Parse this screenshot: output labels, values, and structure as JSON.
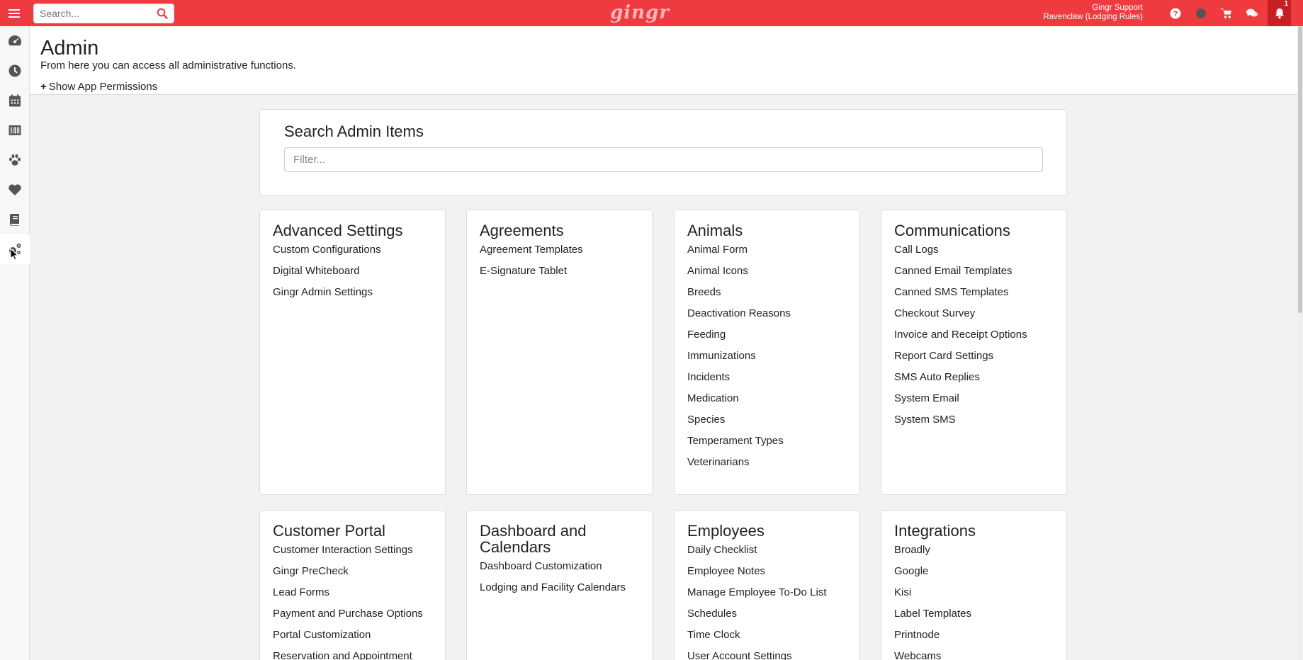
{
  "topbar": {
    "search_placeholder": "Search...",
    "logo_text": "gingr",
    "user_name": "Gingr Support",
    "location": "Ravenclaw (Lodging Rules)",
    "notification_count": "1",
    "brand_color": "#ef3b3f"
  },
  "sidebar": {
    "items": [
      {
        "icon": "dashboard-gauge-icon"
      },
      {
        "icon": "clock-icon"
      },
      {
        "icon": "calendar-icon"
      },
      {
        "icon": "barcode-icon"
      },
      {
        "icon": "paw-icon"
      },
      {
        "icon": "heart-icon"
      },
      {
        "icon": "book-icon"
      },
      {
        "icon": "admin-gears-icon",
        "active": true
      }
    ]
  },
  "header": {
    "title": "Admin",
    "description": "From here you can access all administrative functions.",
    "permissions_link": "Show App Permissions"
  },
  "search_panel": {
    "title": "Search Admin Items",
    "placeholder": "Filter..."
  },
  "cards": [
    {
      "title": "Advanced Settings",
      "items": [
        "Custom Configurations",
        "Digital Whiteboard",
        "Gingr Admin Settings"
      ]
    },
    {
      "title": "Agreements",
      "items": [
        "Agreement Templates",
        "E-Signature Tablet"
      ]
    },
    {
      "title": "Animals",
      "items": [
        "Animal Form",
        "Animal Icons",
        "Breeds",
        "Deactivation Reasons",
        "Feeding",
        "Immunizations",
        "Incidents",
        "Medication",
        "Species",
        "Temperament Types",
        "Veterinarians"
      ]
    },
    {
      "title": "Communications",
      "items": [
        "Call Logs",
        "Canned Email Templates",
        "Canned SMS Templates",
        "Checkout Survey",
        "Invoice and Receipt Options",
        "Report Card Settings",
        "SMS Auto Replies",
        "System Email",
        "System SMS"
      ]
    },
    {
      "title": "Customer Portal",
      "items": [
        "Customer Interaction Settings",
        "Gingr PreCheck",
        "Lead Forms",
        "Payment and Purchase Options",
        "Portal Customization",
        "Reservation and Appointment"
      ]
    },
    {
      "title_line1": "Dashboard and",
      "title_line2": "Calendars",
      "items": [
        "Dashboard Customization",
        "Lodging and Facility Calendars"
      ]
    },
    {
      "title": "Employees",
      "items": [
        "Daily Checklist",
        "Employee Notes",
        "Manage Employee To-Do List",
        "Schedules",
        "Time Clock",
        "User Account Settings"
      ]
    },
    {
      "title": "Integrations",
      "items": [
        "Broadly",
        "Google",
        "Kisi",
        "Label Templates",
        "Printnode",
        "Webcams"
      ]
    }
  ]
}
